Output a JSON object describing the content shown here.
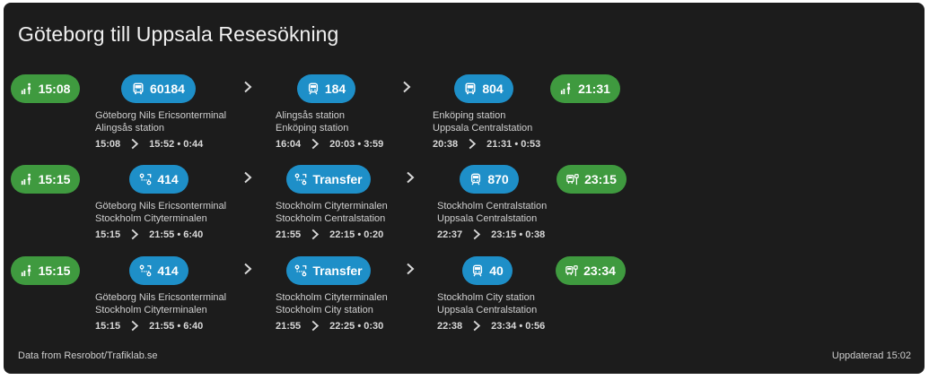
{
  "header": {
    "title": "Göteborg till Uppsala Resesökning"
  },
  "colors": {
    "background": "#1c1c1c",
    "green": "#3f9a3f",
    "blue": "#1e8fc8",
    "text": "#cfcfcf"
  },
  "trips": [
    {
      "departure": {
        "time": "15:08",
        "icon": "walk-signal-icon"
      },
      "legs": [
        {
          "line": "60184",
          "icon": "bus-icon",
          "from": "Göteborg Nils Ericsonterminal",
          "to": "Alingsås station",
          "start": "15:08",
          "end_dur": "15:52 • 0:44"
        },
        {
          "line": "184",
          "icon": "train-icon",
          "from": "Alingsås station",
          "to": "Enköping station",
          "start": "16:04",
          "end_dur": "20:03 • 3:59"
        },
        {
          "line": "804",
          "icon": "bus-icon",
          "from": "Enköping station",
          "to": "Uppsala Centralstation",
          "start": "20:38",
          "end_dur": "21:31 • 0:53"
        }
      ],
      "arrival": {
        "time": "21:31",
        "icon": "walk-signal-icon"
      }
    },
    {
      "departure": {
        "time": "15:15",
        "icon": "walk-signal-icon"
      },
      "legs": [
        {
          "line": "414",
          "icon": "route-icon",
          "from": "Göteborg Nils Ericsonterminal",
          "to": "Stockholm Cityterminalen",
          "start": "15:15",
          "end_dur": "21:55 • 6:40"
        },
        {
          "line": "Transfer",
          "icon": "route-icon",
          "from": "Stockholm Cityterminalen",
          "to": "Stockholm Centralstation",
          "start": "21:55",
          "end_dur": "22:15 • 0:20"
        },
        {
          "line": "870",
          "icon": "train-icon",
          "from": "Stockholm Centralstation",
          "to": "Uppsala Centralstation",
          "start": "22:37",
          "end_dur": "23:15 • 0:38"
        }
      ],
      "arrival": {
        "time": "23:15",
        "icon": "bus-stop-icon"
      }
    },
    {
      "departure": {
        "time": "15:15",
        "icon": "walk-signal-icon"
      },
      "legs": [
        {
          "line": "414",
          "icon": "route-icon",
          "from": "Göteborg Nils Ericsonterminal",
          "to": "Stockholm Cityterminalen",
          "start": "15:15",
          "end_dur": "21:55 • 6:40"
        },
        {
          "line": "Transfer",
          "icon": "route-icon",
          "from": "Stockholm Cityterminalen",
          "to": "Stockholm City station",
          "start": "21:55",
          "end_dur": "22:25 • 0:30"
        },
        {
          "line": "40",
          "icon": "train-icon",
          "from": "Stockholm City station",
          "to": "Uppsala Centralstation",
          "start": "22:38",
          "end_dur": "23:34 • 0:56"
        }
      ],
      "arrival": {
        "time": "23:34",
        "icon": "bus-stop-icon"
      }
    }
  ],
  "footer": {
    "source": "Data from Resrobot/Trafiklab.se",
    "updated": "Uppdaterad 15:02"
  }
}
